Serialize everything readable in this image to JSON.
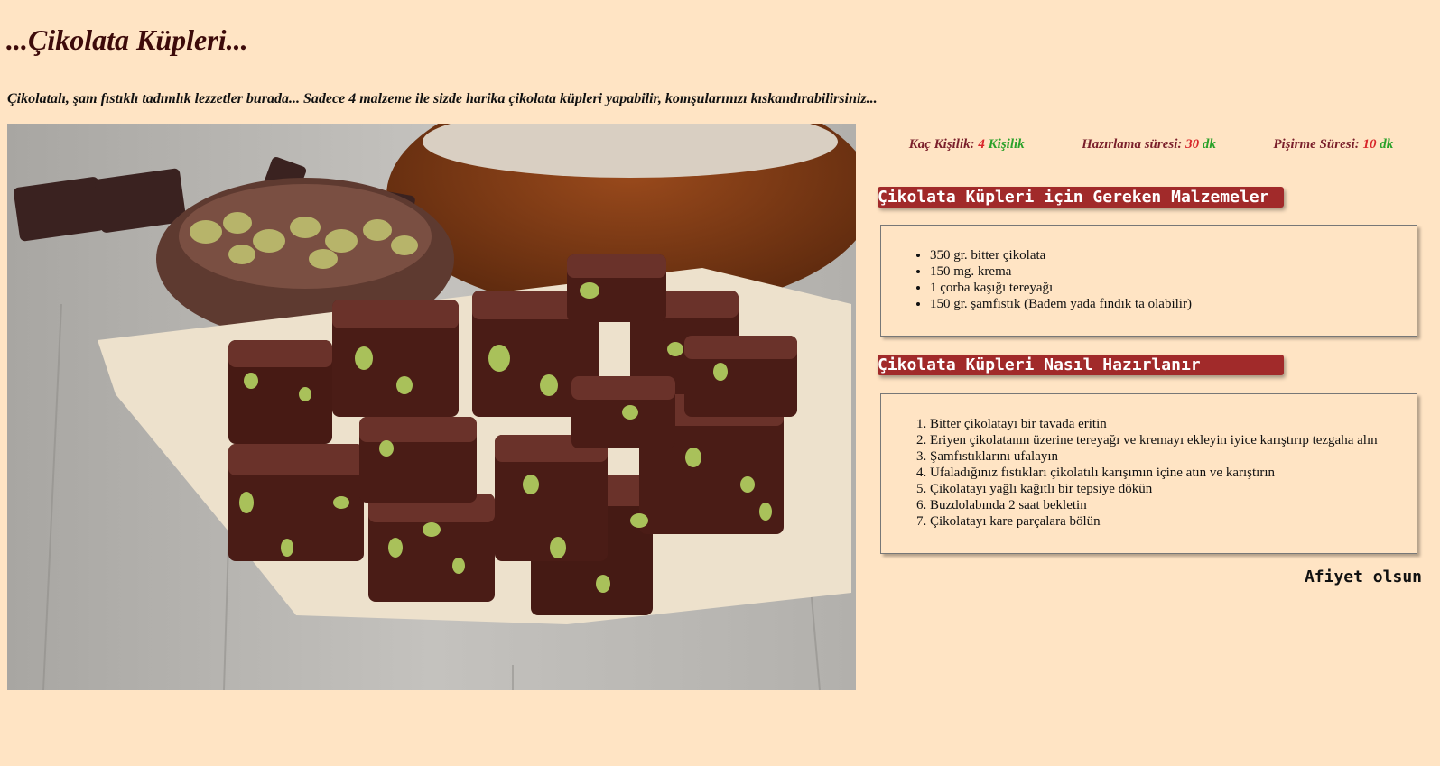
{
  "page": {
    "title": "...Çikolata Küpleri...",
    "intro": "Çikolatalı, şam fıstıklı tadımlık lezzetler burada... Sadece 4 malzeme ile sizde harika çikolata küpleri yapabilir, komşularınızı kıskandırabilirsiniz..."
  },
  "meta": {
    "servings": {
      "label": "Kaç Kişilik:",
      "value": "4",
      "unit": "Kişilik"
    },
    "prep": {
      "label": "Hazırlama süresi:",
      "value": "30",
      "unit": "dk"
    },
    "cook": {
      "label": "Pişirme Süresi:",
      "value": "10",
      "unit": "dk"
    }
  },
  "ingredients": {
    "heading": "Çikolata Küpleri için Gereken Malzemeler",
    "items": [
      "350 gr. bitter çikolata",
      "150 mg. krema",
      "1 çorba kaşığı tereyağı",
      "150 gr. şamfıstık (Badem yada fındık ta olabilir)"
    ]
  },
  "steps": {
    "heading": "Çikolata Küpleri Nasıl Hazırlanır",
    "items": [
      "Bitter çikolatayı bir tavada eritin",
      "Eriyen çikolatanın üzerine tereyağı ve kremayı ekleyin iyice karıştırıp tezgaha alın",
      "Şamfıstıklarını ufalayın",
      "Ufaladığınız fıstıkları çikolatılı karışımın içine atın ve karıştırın",
      "Çikolatayı yağlı kağıtlı bir tepsiye dökün",
      "Buzdolabında 2 saat bekletin",
      "Çikolatayı kare parçalara bölün"
    ]
  },
  "farewell": "Afiyet olsun",
  "colors": {
    "background": "#ffe4c4",
    "heading_bg": "#a12a2a",
    "meta_label": "#7a1f2b",
    "meta_value": "#d8262b",
    "meta_unit": "#2aa12a"
  }
}
